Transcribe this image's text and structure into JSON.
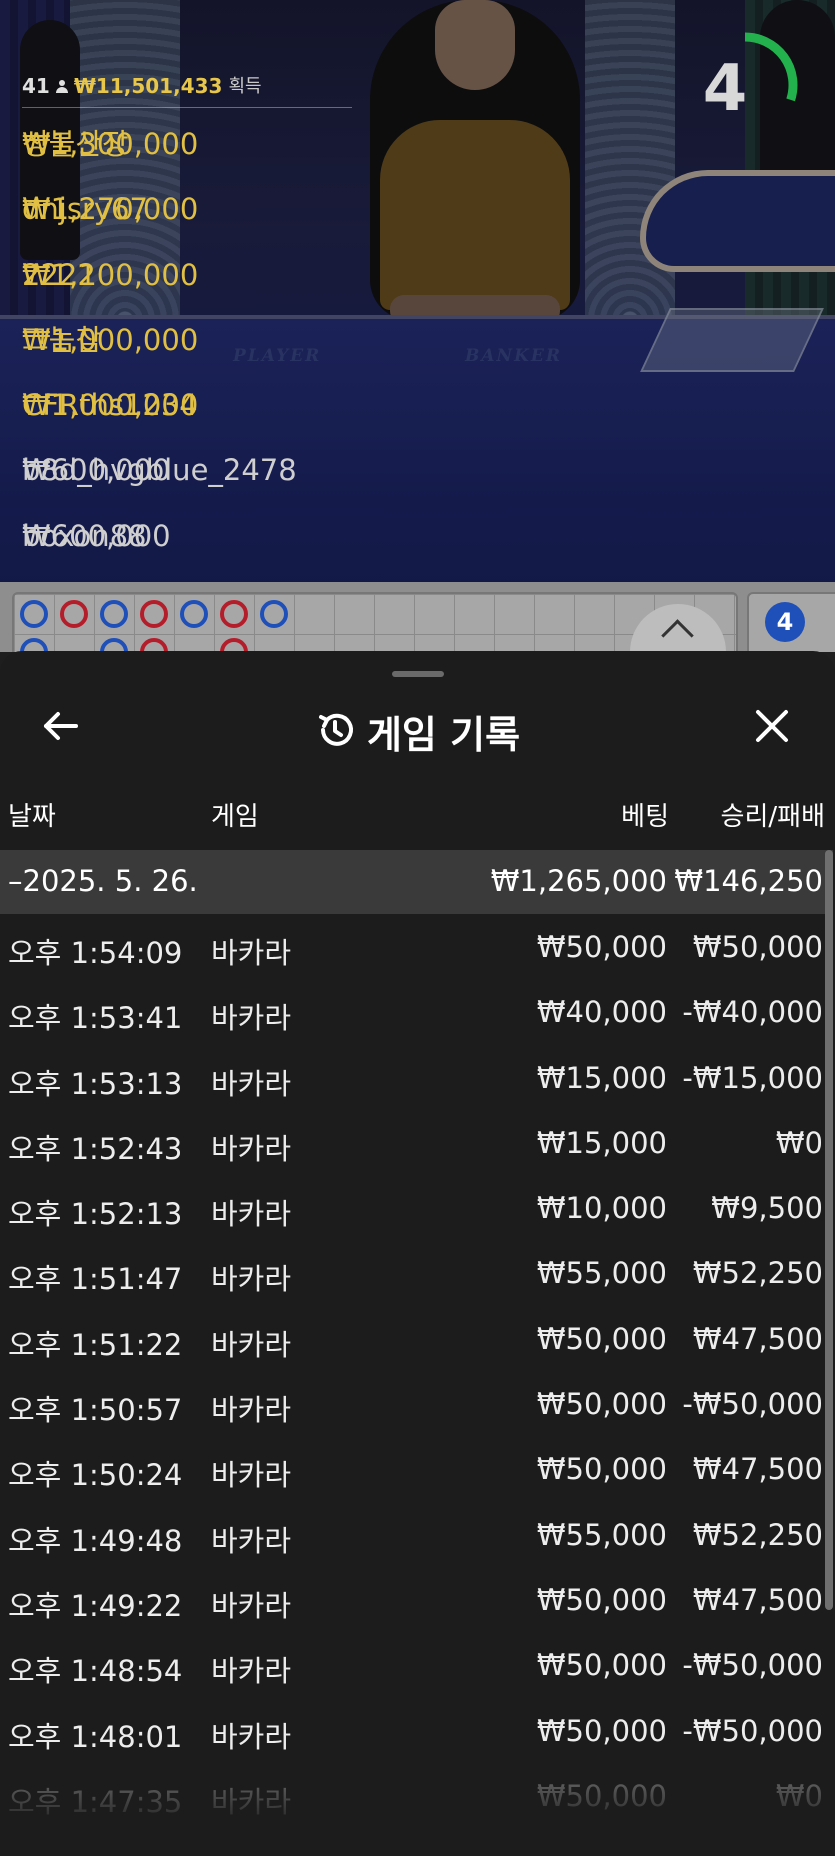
{
  "stream": {
    "table_labels": {
      "player": "PLAYER",
      "banker": "BANKER"
    },
    "winners": {
      "player_count": "41",
      "total": "₩11,501,433",
      "earned_label": "획득",
      "rows": [
        {
          "amount": "₩1,300,000",
          "name": "성불산장"
        },
        {
          "amount": "₩1,270,000",
          "name": "dnjsry67"
        },
        {
          "amount": "₩1,100,000",
          "name": "2222"
        },
        {
          "amount": "₩1,000,000",
          "name": "그놈참"
        },
        {
          "amount": "₩1,000,000",
          "name": "CFRths1234"
        },
        {
          "amount": "₩600,000",
          "name": "b8d_hvgblue_2478"
        },
        {
          "amount": "₩600,000",
          "name": "boxon88"
        }
      ]
    },
    "timer": {
      "value": "4",
      "progress": 0.3,
      "color": "#22b14c"
    },
    "road_card_value": "4"
  },
  "sheet": {
    "title": "게임 기록",
    "icons": {
      "back": "arrow-left-icon",
      "history": "history-icon",
      "close": "close-icon"
    },
    "columns": {
      "date": "날짜",
      "game": "게임",
      "bet": "베팅",
      "win_loss": "승리/패배"
    },
    "date_group": {
      "date": "–2025. 5. 26.",
      "bet_total": "₩1,265,000",
      "win_loss_total": "₩146,250"
    },
    "rows": [
      {
        "time": "오후 1:54:09",
        "game": "바카라",
        "bet": "₩50,000",
        "win_loss": "₩50,000"
      },
      {
        "time": "오후 1:53:41",
        "game": "바카라",
        "bet": "₩40,000",
        "win_loss": "-₩40,000"
      },
      {
        "time": "오후 1:53:13",
        "game": "바카라",
        "bet": "₩15,000",
        "win_loss": "-₩15,000"
      },
      {
        "time": "오후 1:52:43",
        "game": "바카라",
        "bet": "₩15,000",
        "win_loss": "₩0"
      },
      {
        "time": "오후 1:52:13",
        "game": "바카라",
        "bet": "₩10,000",
        "win_loss": "₩9,500"
      },
      {
        "time": "오후 1:51:47",
        "game": "바카라",
        "bet": "₩55,000",
        "win_loss": "₩52,250"
      },
      {
        "time": "오후 1:51:22",
        "game": "바카라",
        "bet": "₩50,000",
        "win_loss": "₩47,500"
      },
      {
        "time": "오후 1:50:57",
        "game": "바카라",
        "bet": "₩50,000",
        "win_loss": "-₩50,000"
      },
      {
        "time": "오후 1:50:24",
        "game": "바카라",
        "bet": "₩50,000",
        "win_loss": "₩47,500"
      },
      {
        "time": "오후 1:49:48",
        "game": "바카라",
        "bet": "₩55,000",
        "win_loss": "₩52,250"
      },
      {
        "time": "오후 1:49:22",
        "game": "바카라",
        "bet": "₩50,000",
        "win_loss": "₩47,500"
      },
      {
        "time": "오후 1:48:54",
        "game": "바카라",
        "bet": "₩50,000",
        "win_loss": "-₩50,000"
      },
      {
        "time": "오후 1:48:01",
        "game": "바카라",
        "bet": "₩50,000",
        "win_loss": "-₩50,000"
      },
      {
        "time": "오후 1:47:35",
        "game": "바카라",
        "bet": "₩50,000",
        "win_loss": "₩0"
      }
    ]
  }
}
